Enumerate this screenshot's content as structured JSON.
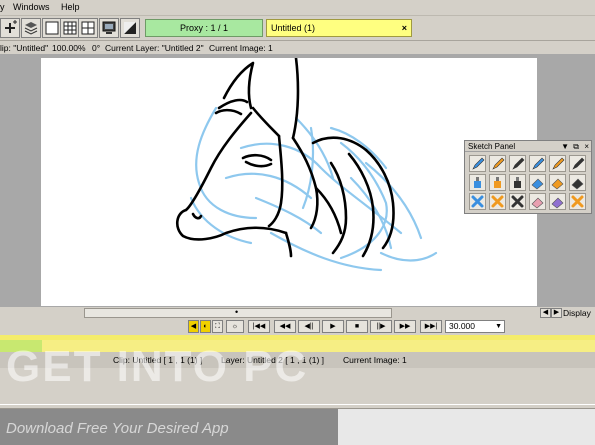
{
  "menubar": {
    "menu_cut": "y",
    "windows": "Windows",
    "help": "Help"
  },
  "toolbar": {
    "proxy_label": "Proxy : 1 / 1",
    "title_tab": "Untitled (1)",
    "title_tab_close": "×",
    "buttons": [
      "add-icon",
      "layers-icon",
      "single-view-icon",
      "grid-view-icon",
      "split-view-icon",
      "monitor-icon",
      "gradient-icon"
    ]
  },
  "infobar": {
    "clip": "lip: \"Untitled\"",
    "zoom": "100.00%",
    "angle": "0°",
    "current_layer": "Current Layer: \"Untitled 2\"",
    "current_image": "Current Image: 1"
  },
  "sketch_panel": {
    "title": "Sketch Panel",
    "tools": [
      "pencil-blue-icon",
      "pencil-orange-icon",
      "pencil-dark-icon",
      "brush-blue-icon",
      "brush-orange-icon",
      "brush-dark-icon",
      "ink-blue-icon",
      "ink-orange-icon",
      "ink-dark-icon",
      "eraser-blue-icon",
      "eraser-orange-icon",
      "eraser-dark-icon",
      "clear-blue-icon",
      "clear-orange-icon",
      "clear-dark-icon",
      "eraser-pink-icon",
      "eraser-purple-icon",
      "clear-multi-icon"
    ]
  },
  "scrollbar": {
    "display_label": "Display",
    "thumb_glyph": "•"
  },
  "transport": {
    "buttons": [
      "|◀◀",
      "◀◀",
      "◀||",
      "▶",
      "■",
      "||▶",
      "▶▶",
      "▶▶|"
    ],
    "fps_value": "30.000",
    "fps_dropdown": "▼"
  },
  "status": {
    "clip": "Clip: Untitled [ 1 , 1   (1) ]",
    "layer": "Layer: Untitled 2 [ 1 , 1   (1) ]",
    "current_image": "Current Image: 1"
  },
  "watermark": {
    "line1": "GET INTO PC",
    "line2": "Download Free Your Desired App"
  },
  "colors": {
    "proxy_bg": "#a8e8a0",
    "tab_bg": "#ffff80",
    "sketch_blue": "#8ec8ee",
    "ink": "#000000"
  }
}
